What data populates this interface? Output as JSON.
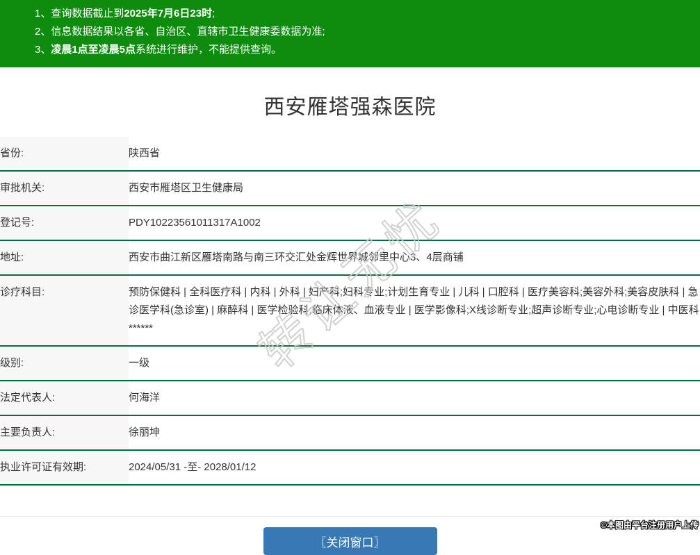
{
  "colors": {
    "header_green": "#0e8c0e",
    "row_border_green": "#0a6b3f",
    "label_bg": "#f7f7f7",
    "text": "#333333",
    "button_blue": "#3879b5",
    "divider_gray": "#ececec"
  },
  "notice": {
    "items": [
      {
        "prefix": "1、查询数据截止到",
        "bold": "2025年7月6日23时",
        "suffix": ";"
      },
      {
        "prefix": "2、信息数据结果以各省、自治区、直辖市卫生健康委数据为准;",
        "bold": "",
        "suffix": ""
      },
      {
        "prefix": "3、",
        "bold": "凌晨1点至凌晨5点",
        "suffix": "系统进行维护，不能提供查询。"
      }
    ]
  },
  "title": "西安雁塔强森医院",
  "table": {
    "rows": [
      {
        "label": "省份:",
        "value": "陕西省"
      },
      {
        "label": "审批机关:",
        "value": "西安市雁塔区卫生健康局"
      },
      {
        "label": "登记号:",
        "value": "PDY10223561011317A1002"
      },
      {
        "label": "地址:",
        "value": "西安市曲江新区雁塔南路与南三环交汇处金辉世界城邻里中心3、4层商铺"
      },
      {
        "label": "诊疗科目:",
        "value": "预防保健科 | 全科医疗科 | 内科 | 外科 | 妇产科;妇科专业;计划生育专业 | 儿科 | 口腔科 | 医疗美容科;美容外科;美容皮肤科 | 急诊医学科(急诊室) | 麻醉科 | 医学检验科;临床体液、血液专业 | 医学影像科;X线诊断专业;超声诊断专业;心电诊断专业 | 中医科******"
      },
      {
        "label": "级别:",
        "value": "一级"
      },
      {
        "label": "法定代表人:",
        "value": "何海洋"
      },
      {
        "label": "主要负责人:",
        "value": "徐丽坤"
      },
      {
        "label": "执业许可证有效期:",
        "value": "2024/05/31 -至- 2028/01/12"
      }
    ]
  },
  "footer": {
    "close_button_label": "〖关闭窗口〗"
  },
  "watermark_text": "转让无忧",
  "attribution": "©本图由平台注册用户上传"
}
